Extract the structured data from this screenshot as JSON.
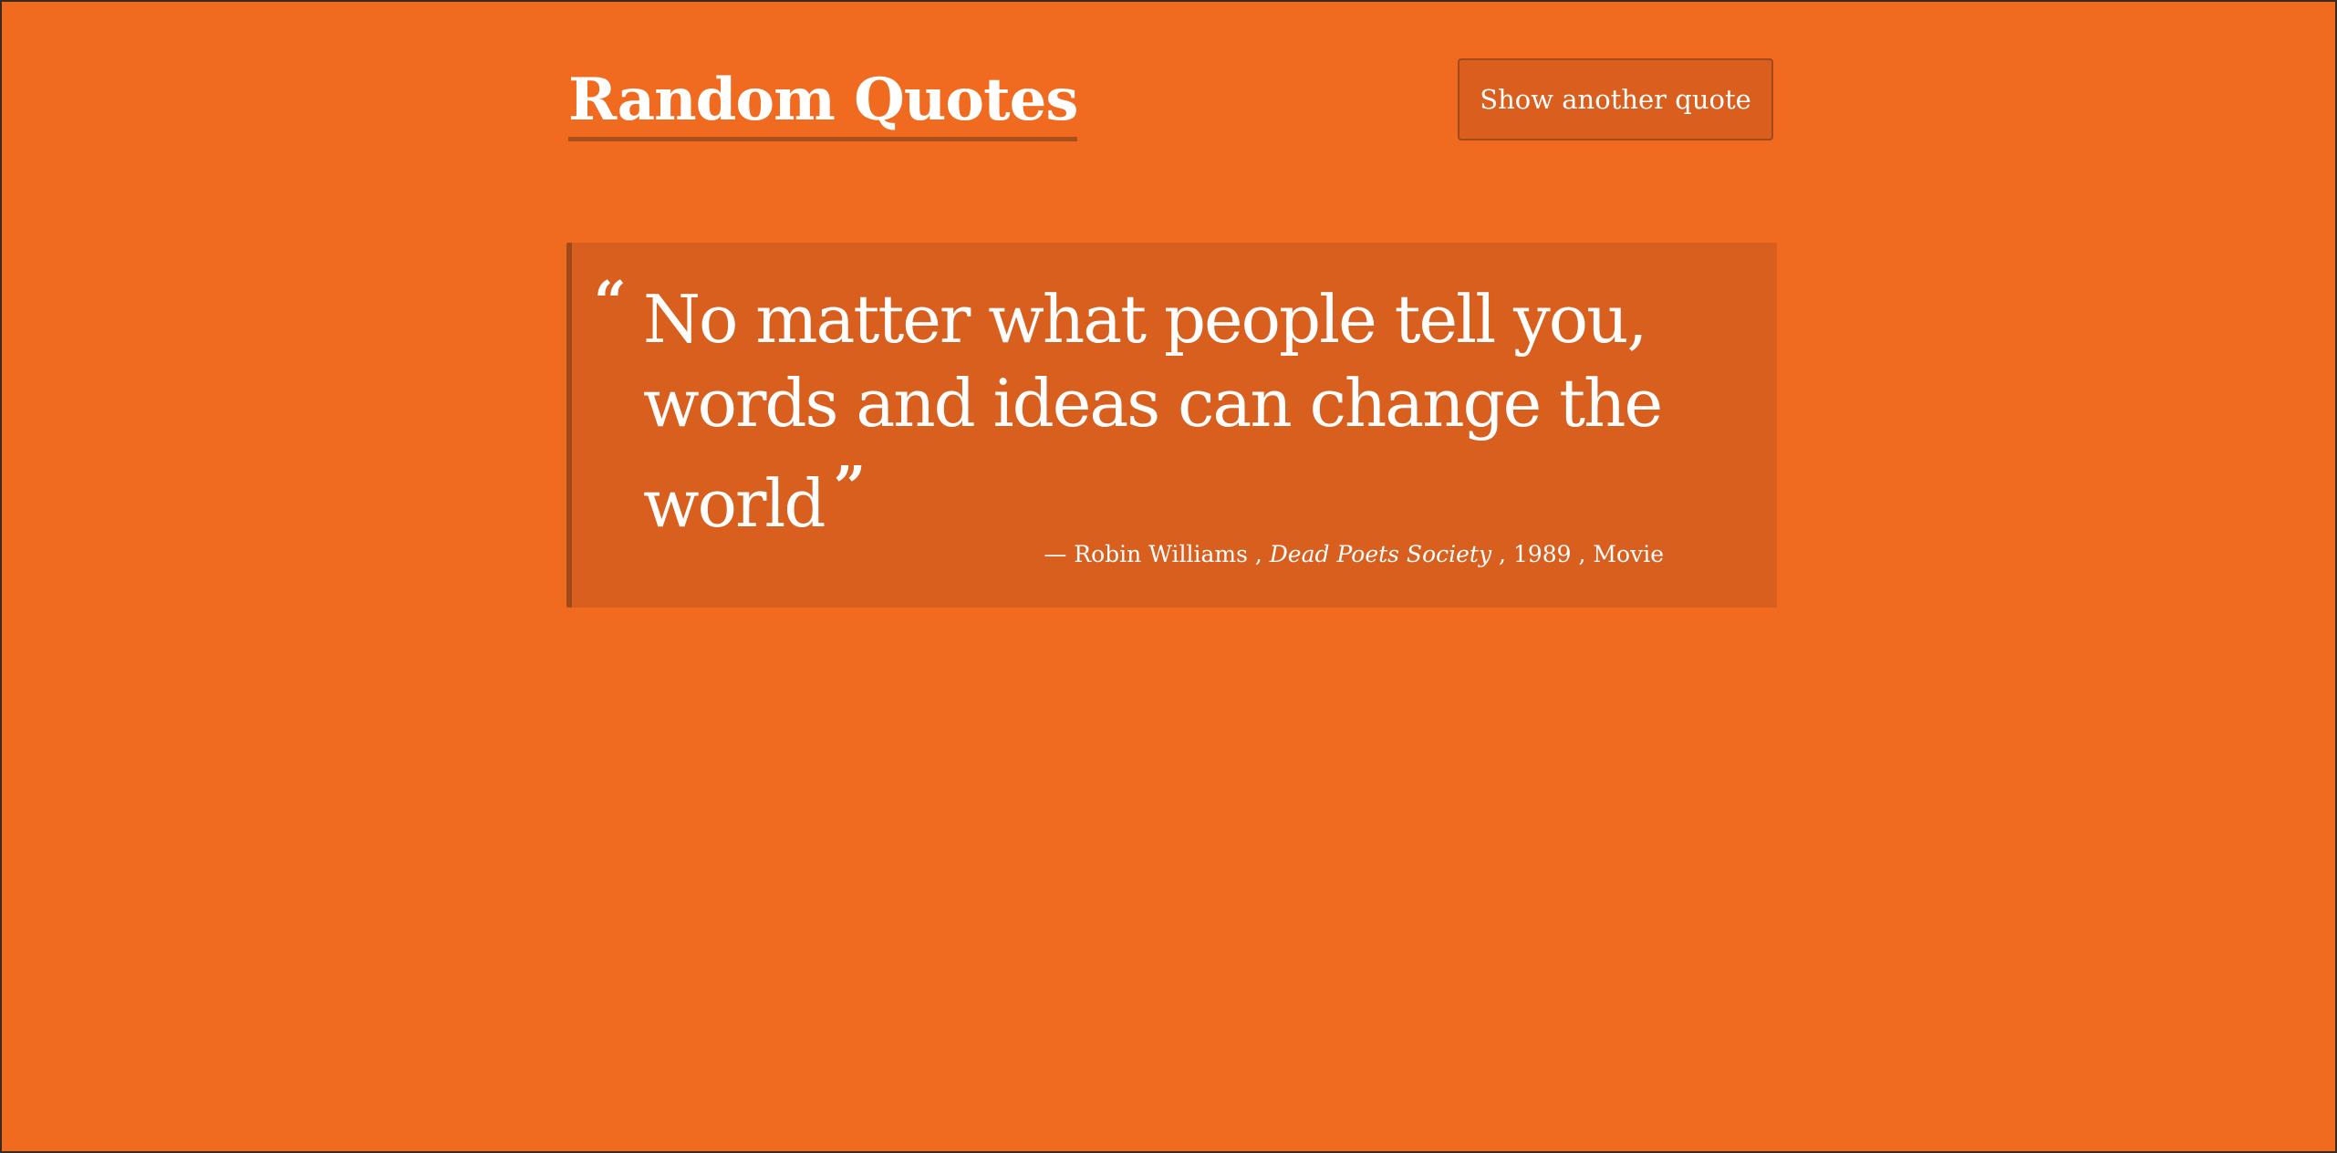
{
  "header": {
    "title": "Random Quotes",
    "button_label": "Show another quote"
  },
  "quote": {
    "open_mark": "“",
    "text": "No matter what people tell you, words and ideas can change the world",
    "close_mark": "”",
    "dash": "—",
    "author": "Robin Williams",
    "work": "Dead Poets Society",
    "year": "1989",
    "medium": "Movie",
    "separator": ","
  },
  "colors": {
    "background": "#f06b20",
    "card": "#d95f1e",
    "accent_border": "#a04a1a",
    "text": "#ffffff"
  }
}
